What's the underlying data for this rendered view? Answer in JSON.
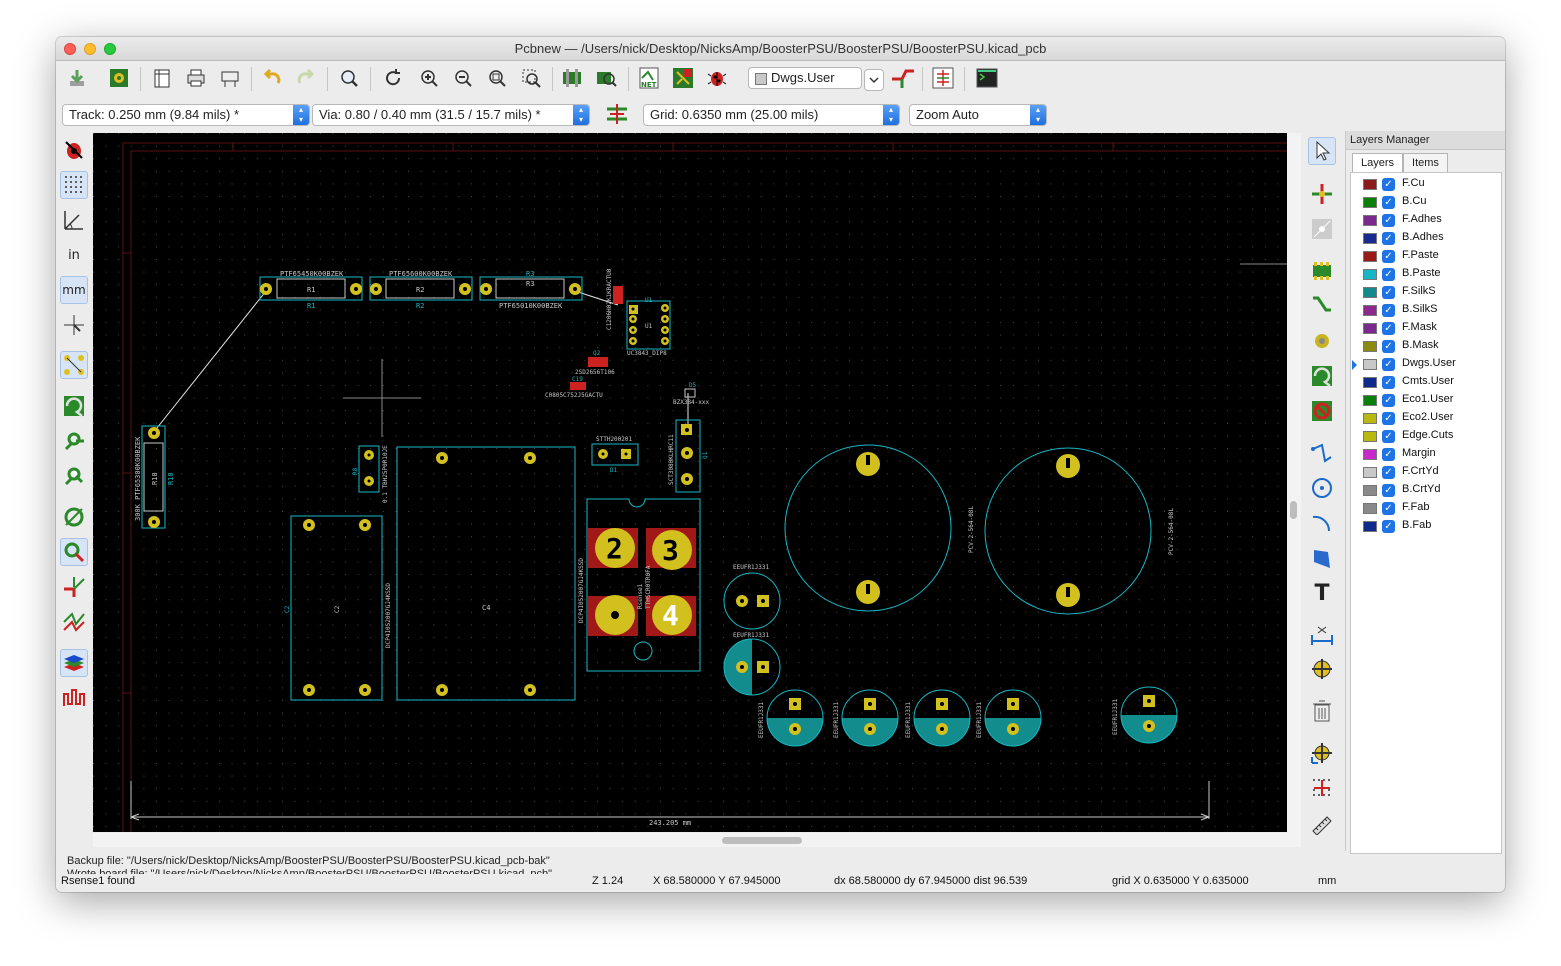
{
  "window": {
    "title": "Pcbnew — /Users/nick/Desktop/NicksAmp/BoosterPSU/BoosterPSU/BoosterPSU.kicad_pcb"
  },
  "toolbar": {
    "active_layer": "Dwgs.User",
    "track": "Track: 0.250 mm (9.84 mils) *",
    "via": "Via: 0.80 / 0.40 mm (31.5 / 15.7 mils) *",
    "grid": "Grid: 0.6350 mm (25.00 mils)",
    "zoom": "Zoom Auto",
    "icons": [
      "save-icon",
      "board-setup-icon",
      "page-settings-icon",
      "print-icon",
      "plot-icon",
      "undo-icon",
      "redo-icon",
      "find-icon",
      "redraw-icon",
      "zoom-in-icon",
      "zoom-out-icon",
      "zoom-fit-icon",
      "zoom-selection-icon",
      "footprint-editor-icon",
      "footprint-viewer-icon",
      "netlist-icon",
      "update-pcb-icon",
      "drc-icon",
      "layer-pair-icon",
      "autoroute-icon",
      "schematic-icon",
      "scripting-console-icon"
    ]
  },
  "left_toolbar": {
    "icons": [
      "drc-marker-icon",
      "grid-toggle-icon",
      "polar-coords-icon",
      "inch-units-icon",
      "mm-units-icon",
      "full-cursor-icon",
      "ratsnest-icon",
      "show-pads-icon",
      "show-vias-icon",
      "show-tracks-icon",
      "show-zones-icon",
      "zone-outline-icon",
      "net-highlight-icon",
      "microwave-icon",
      "layers-manager-icon",
      "length-tune-icon"
    ],
    "inch_label": "in",
    "mm_label": "mm"
  },
  "right_toolbar": {
    "icons": [
      "select-icon",
      "highlight-net-icon",
      "local-ratsnest-icon",
      "add-footprint-icon",
      "route-track-icon",
      "add-via-icon",
      "add-zone-icon",
      "add-keepout-icon",
      "add-line-icon",
      "add-circle-icon",
      "add-arc-icon",
      "add-polygon-icon",
      "add-text-icon",
      "add-dimension-icon",
      "add-target-icon",
      "delete-icon",
      "set-origin-icon",
      "grid-origin-icon",
      "measure-icon"
    ],
    "text_tool": "T"
  },
  "layers_manager": {
    "title": "Layers Manager",
    "tabs": [
      "Layers",
      "Items"
    ],
    "active_tab": "Layers",
    "layers": [
      {
        "name": "F.Cu",
        "color": "#8b1a1a"
      },
      {
        "name": "B.Cu",
        "color": "#0a7f0a"
      },
      {
        "name": "F.Adhes",
        "color": "#7a2a8c"
      },
      {
        "name": "B.Adhes",
        "color": "#1a2a8c"
      },
      {
        "name": "F.Paste",
        "color": "#9a1a1a"
      },
      {
        "name": "B.Paste",
        "color": "#17b6c4"
      },
      {
        "name": "F.SilkS",
        "color": "#158a8a"
      },
      {
        "name": "B.SilkS",
        "color": "#8c2a8c"
      },
      {
        "name": "F.Mask",
        "color": "#7a2a8c"
      },
      {
        "name": "B.Mask",
        "color": "#8a8a10"
      },
      {
        "name": "Dwgs.User",
        "color": "#c8c8c8"
      },
      {
        "name": "Cmts.User",
        "color": "#102a8c"
      },
      {
        "name": "Eco1.User",
        "color": "#0a7f0a"
      },
      {
        "name": "Eco2.User",
        "color": "#b8b810"
      },
      {
        "name": "Edge.Cuts",
        "color": "#b8b810"
      },
      {
        "name": "Margin",
        "color": "#c82ac8"
      },
      {
        "name": "F.CrtYd",
        "color": "#c8c8c8"
      },
      {
        "name": "B.CrtYd",
        "color": "#8a8a8a"
      },
      {
        "name": "F.Fab",
        "color": "#8a8a8a"
      },
      {
        "name": "B.Fab",
        "color": "#102a8c"
      }
    ],
    "selected_layer": "Dwgs.User"
  },
  "board": {
    "components": {
      "r1_ref": "R1",
      "r1_value": "PTF65450K00BZEK",
      "r2_ref": "R2",
      "r2_value": "PTF65600K00BZEK",
      "r3_ref": "R3",
      "r3_value": "PTF65010K00BZEK",
      "u1_ref": "U1",
      "u1_value": "UC3843_DIP8",
      "r10_ref": "R10",
      "r10_value": "300K PTF65300K00BZEK",
      "c12_value": "C1206H02K1KRACTU0",
      "q2_ref": "Q2",
      "q2_value": "2SD2656T106",
      "c19_ref": "C19",
      "c19_value": "C0805C752J5GACTU",
      "d5_ref": "D5",
      "d5_value": "BZX384-xxx",
      "d1_ref": "D1",
      "d1_value": "STTH200201",
      "q1_ref": "Q1",
      "q1_value": "SCT3080KLHRC11",
      "r8_ref": "R8",
      "r8_value": "0.1 TBH25P0R10JE",
      "c2_ref": "C2",
      "c4_ref": "C4",
      "c3_ref": "C3",
      "c_film_value": "DCP4I052007GJ4KSSD",
      "bridge_value": "Rsense1",
      "bridge_pads": [
        "2",
        "3",
        "4"
      ],
      "bridge_text": "TTHSCR0TR0FA",
      "bigcap_value": "PCV-2-564-08L",
      "small_cap_value": "EEUFR1J331",
      "dimension": "243.205 mm"
    }
  },
  "messages": {
    "line1": "Backup file: \"/Users/nick/Desktop/NicksAmp/BoosterPSU/BoosterPSU/BoosterPSU.kicad_pcb-bak\"",
    "line2": "Wrote board file: \"/Users/nick/Desktop/NicksAmp/BoosterPSU/BoosterPSU/BoosterPSU.kicad_pcb\""
  },
  "status": {
    "message": "Rsense1 found",
    "zoom": "Z 1.24",
    "coords": "X 68.580000  Y 67.945000",
    "delta": "dx 68.580000  dy 67.945000  dist 96.539",
    "grid": "grid X 0.635000  Y 0.635000",
    "units": "mm"
  }
}
